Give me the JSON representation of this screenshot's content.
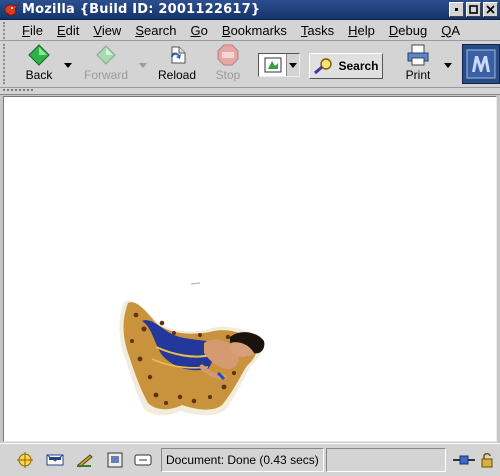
{
  "window": {
    "title": "Mozilla {Build ID: 2001122617}",
    "menu_icon": "mozilla-lizard-icon",
    "buttons": [
      "window-minimize-icon",
      "window-maximize-icon",
      "window-close-icon"
    ]
  },
  "menubar": {
    "items": [
      {
        "label": "File",
        "mnemonic": "F"
      },
      {
        "label": "Edit",
        "mnemonic": "E"
      },
      {
        "label": "View",
        "mnemonic": "V"
      },
      {
        "label": "Search",
        "mnemonic": "S"
      },
      {
        "label": "Go",
        "mnemonic": "G"
      },
      {
        "label": "Bookmarks",
        "mnemonic": "B"
      },
      {
        "label": "Tasks",
        "mnemonic": "T"
      },
      {
        "label": "Help",
        "mnemonic": "H"
      },
      {
        "label": "Debug",
        "mnemonic": "D"
      },
      {
        "label": "QA",
        "mnemonic": "Q"
      }
    ]
  },
  "toolbar": {
    "back": {
      "label": "Back",
      "icon": "back-arrow-icon",
      "enabled": true
    },
    "forward": {
      "label": "Forward",
      "icon": "forward-arrow-icon",
      "enabled": false
    },
    "reload": {
      "label": "Reload",
      "icon": "reload-icon",
      "enabled": true
    },
    "stop": {
      "label": "Stop",
      "icon": "stop-icon",
      "enabled": false
    },
    "theme_selector": {
      "icon": "theme-preview-icon"
    },
    "search": {
      "label": "Search",
      "icon": "search-magnifier-icon"
    },
    "print": {
      "label": "Print",
      "icon": "printer-icon",
      "enabled": true
    },
    "throbber": {
      "icon": "mozilla-m-logo-icon"
    }
  },
  "content": {
    "image": "dancer-photo"
  },
  "statusbar": {
    "text": "Document: Done (0.43 secs)",
    "icons": [
      "navigator-icon",
      "mail-icon",
      "composer-icon",
      "address-book-icon",
      "chatzilla-icon"
    ],
    "right_icons": [
      "online-connection-icon",
      "security-lock-icon"
    ]
  },
  "colors": {
    "titlebar": "#1f3f7a",
    "chrome": "#d4d4d4",
    "page_background": "#ffffff"
  }
}
